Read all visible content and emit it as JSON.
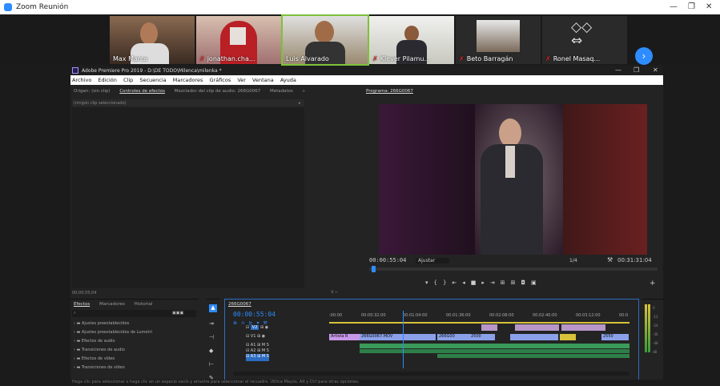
{
  "zoom": {
    "title": "Zoom Reunión"
  },
  "gallery": {
    "participants": [
      {
        "name": "Max Marca",
        "muted": false
      },
      {
        "name": "jonathan.cha...",
        "muted": true
      },
      {
        "name": "Luis Alvarado",
        "muted": false
      },
      {
        "name": "Klever Pilamu...",
        "muted": true
      },
      {
        "name": "Beto Barragán",
        "muted": true
      },
      {
        "name": "Ronel Masaq...",
        "muted": true
      }
    ]
  },
  "premiere": {
    "title": "Adobe Premiere Pro 2019 - D:\\DE TODO\\Milenca\\milenka *",
    "menu": [
      "Archivo",
      "Edición",
      "Clip",
      "Secuencia",
      "Marcadores",
      "Gráficos",
      "Ver",
      "Ventana",
      "Ayuda"
    ],
    "source_tabs": [
      "Origen: (sin clip)",
      "Controles de efectos",
      "Mezclador del clip de audio: 266G0067",
      "Metadatos"
    ],
    "no_clip": "(ningún clip seleccionado)",
    "source_timecode": "00;00;55;04",
    "program_tab": "Programa: 266G0067",
    "program_timecode": "00:00:55:04",
    "fit": "Ajustar",
    "resolution": "1/4",
    "duration": "00:31:31:04",
    "effects_tabs": [
      "Efectos",
      "Marcadores",
      "Historial"
    ],
    "effects_items": [
      "Ajustes preestablecidos",
      "Ajustes preestablecidos de Lumetri",
      "Efectos de audio",
      "Transiciones de audio",
      "Efectos de vídeo",
      "Transiciones de vídeo"
    ],
    "sequence_tab": "266G0067",
    "sequence_timecode": "00:00:55:04",
    "ruler": [
      ":00:00",
      "00:00:32:00",
      "00:01:04:00",
      "00:01:36:00",
      "00:02:08:00",
      "00:02:40:00",
      "00:03:12:00",
      "00:0"
    ],
    "tracks": [
      "V2",
      "V1",
      "A1",
      "A2",
      "A3"
    ],
    "clips": [
      "Artista R",
      "266G0067.MOV",
      "266G00",
      "2500",
      "2550"
    ],
    "meter_labels": [
      "0",
      "-12",
      "-24",
      "-36",
      "-48",
      "dB"
    ],
    "status": "Haga clic para seleccionar o haga clic en un espacio vacío y arrastre para seleccionar el recuadro. Utilice Mayús, Alt y Ctrl para otras opciones."
  }
}
